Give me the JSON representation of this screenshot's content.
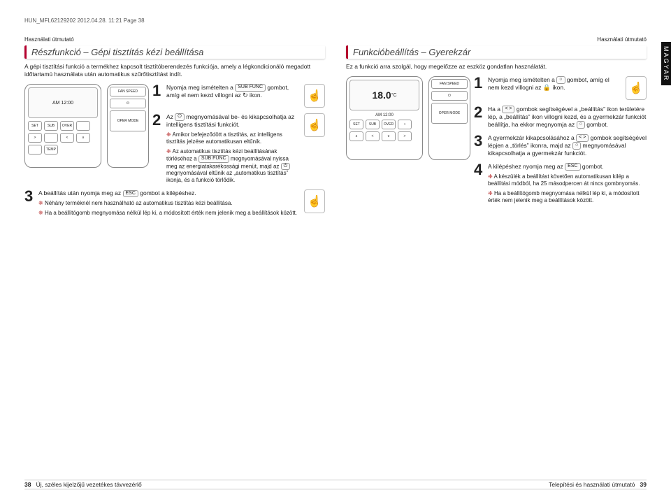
{
  "meta": {
    "top_line": "HUN_MFL62129202 2012.04.28. 11:21 Page 38"
  },
  "language_tab": "MAGYAR",
  "header": {
    "left": "Használati útmutató",
    "right": "Használati útmutató"
  },
  "left": {
    "section_title": "Részfunkció – Gépi tisztítás kézi beállítása",
    "intro": "A gépi tisztítási funkció a termékhez kapcsolt tisztítóberendezés funkciója, amely a légkondicionáló megadott időtartamú használata után automatikus szűrőtisztítást indít.",
    "steps": {
      "s1": {
        "num": "1",
        "text_a": "Nyomja meg ismételten a ",
        "btn": "SUB FUNC",
        "text_b": " gombot, amíg el nem kezd villogni az ",
        "icon": "↻",
        "text_c": " ikon."
      },
      "s2": {
        "num": "2",
        "text_a": "Az ",
        "btn": "⏻",
        "text_b": " megnyomásával be- és kikapcsolhatja az intelligens tisztítási funkciót.",
        "note1": "Amikor befejeződött a tisztítás, az intelligens tisztítás jelzése automatikusan eltűnik.",
        "note2_a": "Az automatikus tisztítás kézi beállításának törléséhez a ",
        "note2_btn": "SUB FUNC",
        "note2_b": " megnyomásával nyissa meg az energiatakarékossági menüt, majd az ",
        "note2_btn2": "⏻",
        "note2_c": " megnyomásával eltűnik az „automatikus tisztítás” ikonja, és a funkció törlődik."
      },
      "s3": {
        "num": "3",
        "text_a": "A beállítás után nyomja meg az ",
        "btn": "ESC",
        "text_b": " gombot a kilépéshez.",
        "note1": "Néhány terméknél nem használható az automatikus tisztítás kézi beállítása.",
        "note2": "Ha a beállítógomb megnyomása nélkül lép ki, a módosított érték nem jelenik meg a beállítások között."
      }
    },
    "remote": {
      "screen": "AM 12:00",
      "btns": [
        "SET",
        "SUB",
        "OVER",
        "",
        ">",
        "",
        "<",
        "∨",
        "",
        "TEMP"
      ],
      "btn_fan": "FAN SPEED",
      "btn_mode": "OPER MODE"
    }
  },
  "right": {
    "section_title": "Funkcióbeállítás – Gyerekzár",
    "intro": "Ez a funkció arra szolgál, hogy megelőzze az eszköz gondatlan használatát.",
    "display": {
      "temp": "18.0",
      "unit": "°C",
      "clock": "AM 12:00"
    },
    "steps": {
      "s1": {
        "num": "1",
        "text_a": "Nyomja meg ismételten a ",
        "btn": "○",
        "text_b": " gombot, amíg el nem kezd villogni az ",
        "icon": "🔒",
        "text_c": " ikon."
      },
      "s2": {
        "num": "2",
        "text_a": "Ha a ",
        "arrows": "< >",
        "text_b": " gombok segítségével a „beállítás” ikon területére lép, a „beállítás” ikon villogni kezd, és a gyermekzár funkciót beállítja, ha ekkor megnyomja az ",
        "btn": "○",
        "text_c": " gombot."
      },
      "s3": {
        "num": "3",
        "text_a": "A gyermekzár kikapcsolásához a ",
        "arrows": "< >",
        "text_b": " gombok segítségével lépjen a „törlés” ikonra, majd az ",
        "btn": "○",
        "text_c": " megnyomásával kikapcsolhatja a gyermekzár funkciót."
      },
      "s4": {
        "num": "4",
        "text_a": "A kilépéshez nyomja meg az ",
        "btn": "ESC",
        "text_b": " gombot.",
        "note1": "A készülék a beállítást követően automatikusan kilép a beállítási módból, ha 25 másodpercen át nincs gombnyomás.",
        "note2": "Ha a beállítógomb megnyomása nélkül lép ki, a módosított érték nem jelenik meg a beállítások között."
      }
    }
  },
  "footer": {
    "left_num": "38",
    "left_text": "Új, széles kijelzőjű vezetékes távvezérlő",
    "right_text": "Telepítési és használati útmutató",
    "right_num": "39"
  }
}
